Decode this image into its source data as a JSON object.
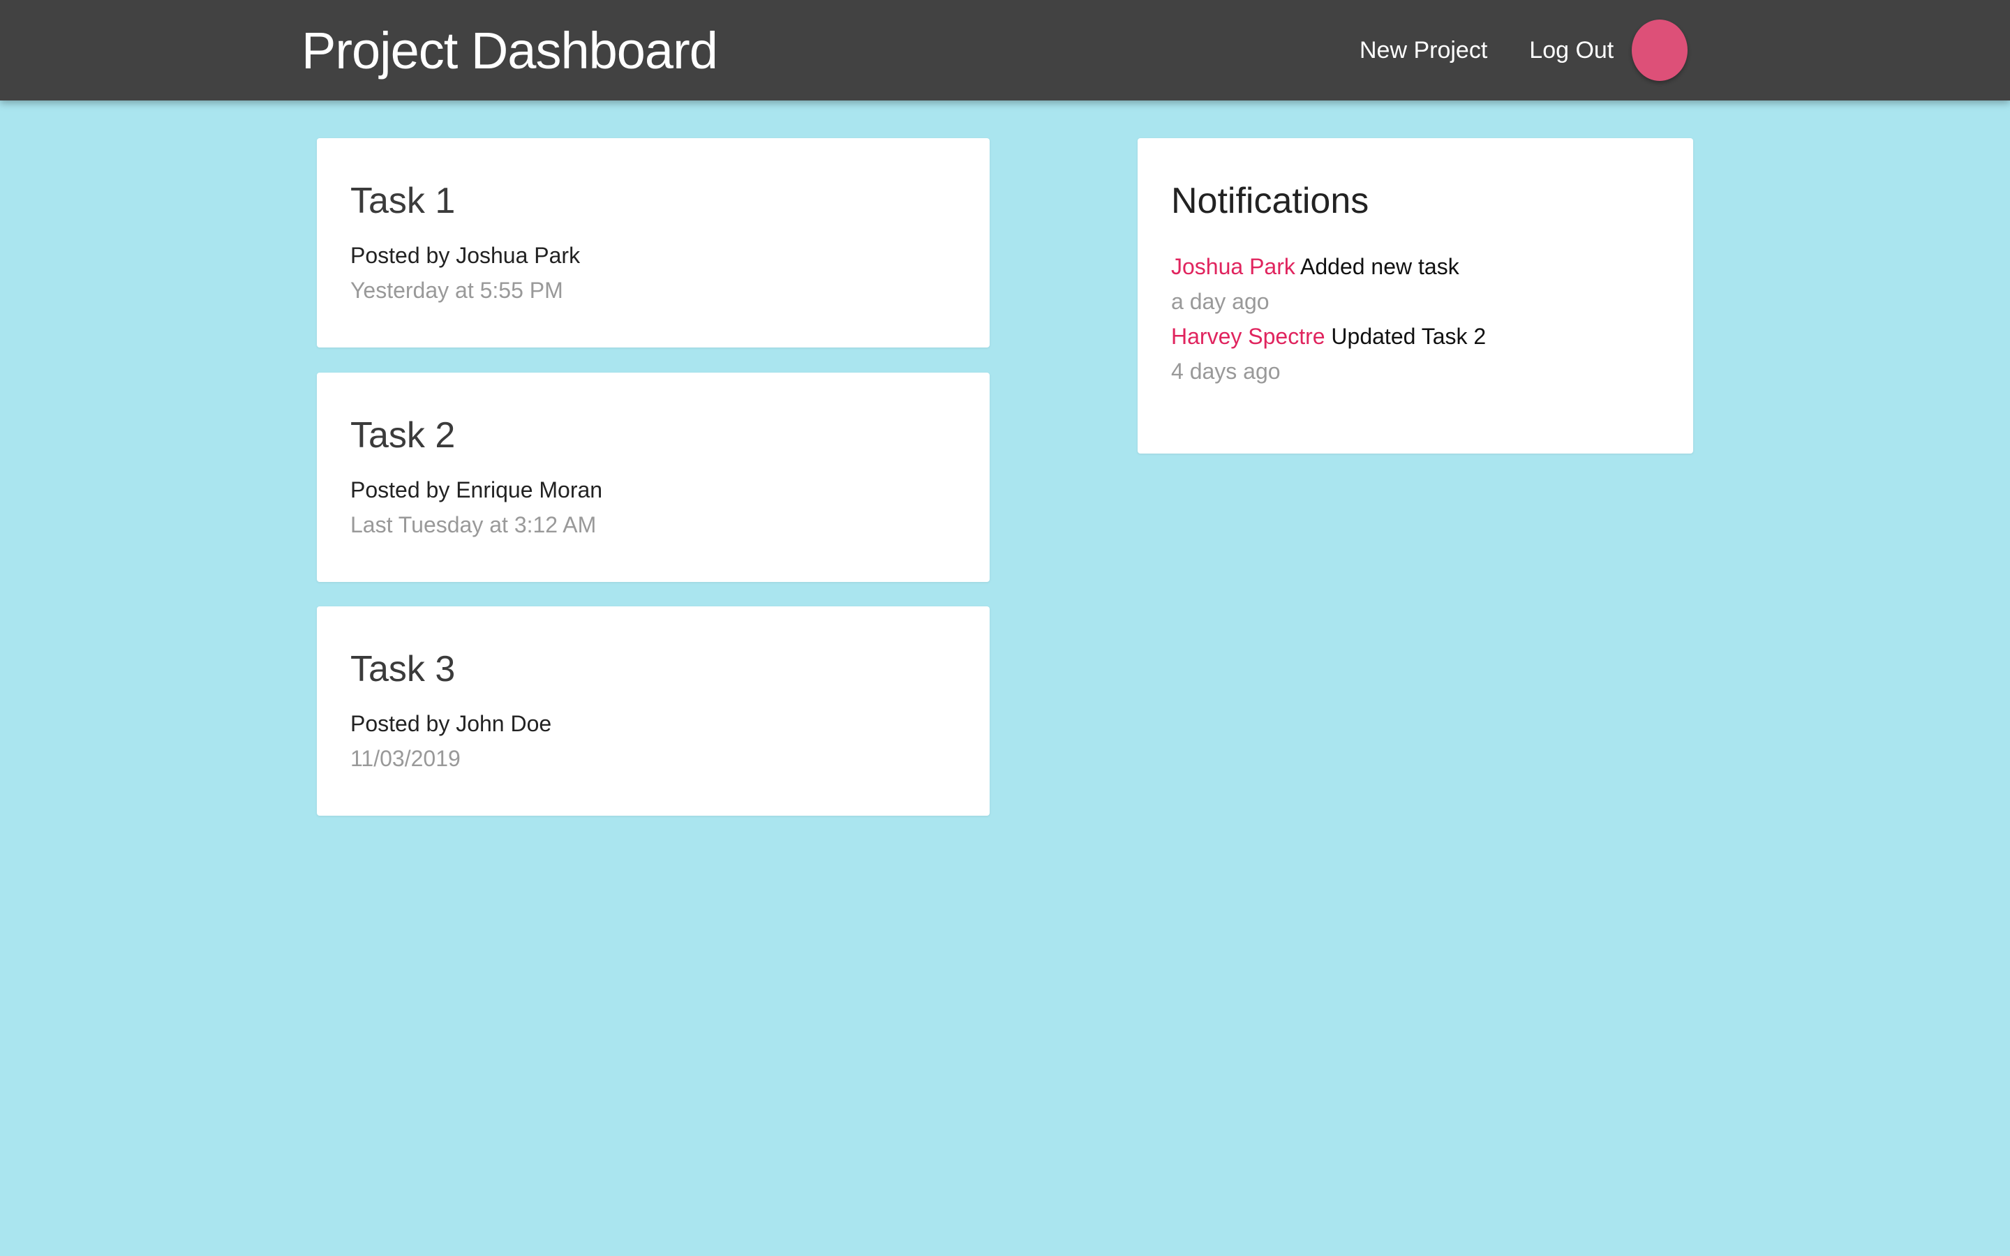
{
  "navbar": {
    "title": "Project Dashboard",
    "links": [
      "New Project",
      "Log Out"
    ],
    "avatar_color": "#dd5078"
  },
  "tasks": [
    {
      "title": "Task 1",
      "author": "Posted by Joshua Park",
      "date": "Yesterday at 5:55 PM"
    },
    {
      "title": "Task 2",
      "author": "Posted by Enrique Moran",
      "date": "Last Tuesday at 3:12 AM"
    },
    {
      "title": "Task 3",
      "author": "Posted by John Doe",
      "date": "11/03/2019"
    }
  ],
  "notifications": {
    "title": "Notifications",
    "items": [
      {
        "user": "Joshua Park",
        "action": "Added new task",
        "time": "a day ago"
      },
      {
        "user": "Harvey Spectre",
        "action": "Updated Task 2",
        "time": "4 days ago"
      }
    ]
  },
  "colors": {
    "background": "#aae5ef",
    "navbar": "#424242",
    "accent": "#e0245e"
  }
}
